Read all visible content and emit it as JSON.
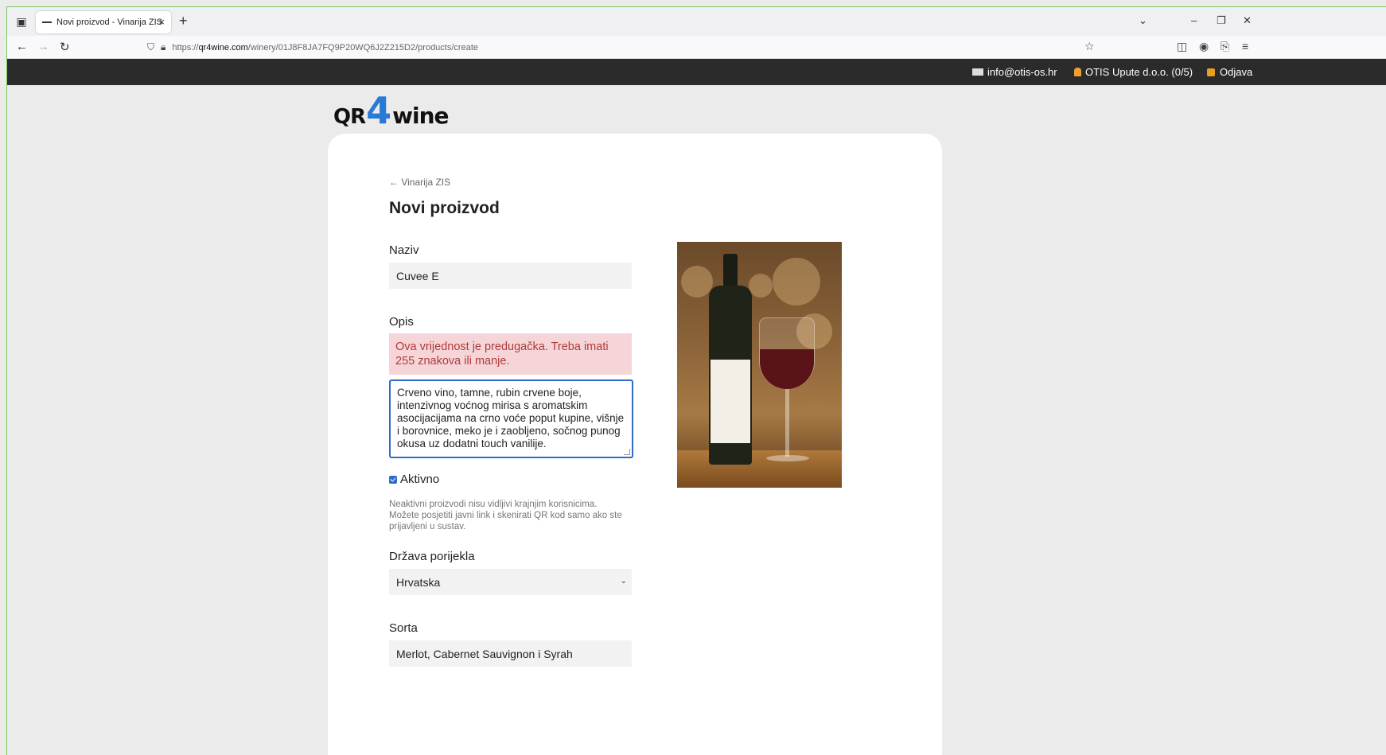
{
  "browser": {
    "tab_title": "Novi proizvod - Vinarija ZIS",
    "tab_close": "×",
    "new_tab": "+",
    "url_prefix": "https://",
    "url_host": "qr4wine.com",
    "url_path": "/winery/01J8F8JA7FQ9P20WQ6J2Z215D2/products/create"
  },
  "topbar": {
    "email": "info@otis-os.hr",
    "company": "OTIS Upute d.o.o. (0/5)",
    "logout": "Odjava"
  },
  "logo": {
    "part1": "QR",
    "part2": "4",
    "part3": "wine"
  },
  "page": {
    "back_link": "← Vinarija ZIS",
    "title": "Novi proizvod"
  },
  "form": {
    "name_label": "Naziv",
    "name_value": "Cuvee E",
    "desc_label": "Opis",
    "desc_error": "Ova vrijednost je predugačka. Treba imati 255 znakova ili manje.",
    "desc_value": "Crveno vino, tamne, rubin crvene boje, intenzivnog voćnog mirisa s aromatskim asocijacijama na crno voće poput kupine, višnje i borovnice, meko je i zaobljeno, sočnog punog okusa uz dodatni touch vanilije.",
    "active_label": "Aktivno",
    "active_checked": true,
    "active_help": "Neaktivni proizvodi nisu vidljivi krajnjim korisnicima. Možete posjetiti javni link i skenirati QR kod samo ako ste prijavljeni u sustav.",
    "country_label": "Država porijekla",
    "country_value": "Hrvatska",
    "variety_label": "Sorta",
    "variety_value": "Merlot, Cabernet Sauvignon i Syrah"
  },
  "colors": {
    "accent": "#2979d6",
    "error_bg": "#f6d5d8",
    "error_text": "#b03a3a",
    "topbar_bg": "#2b2b2b"
  }
}
